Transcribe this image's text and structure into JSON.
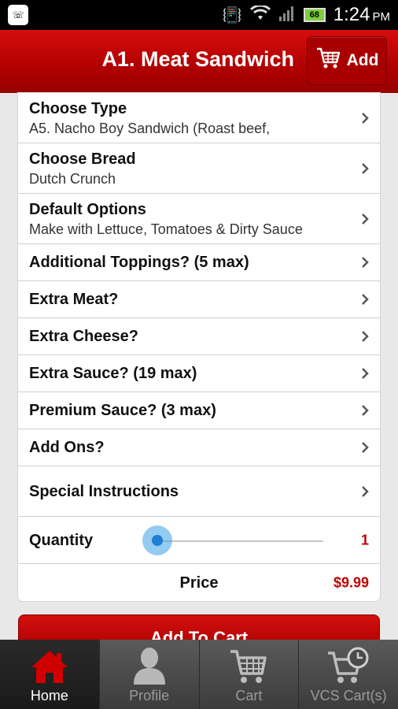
{
  "status_bar": {
    "time": "1:24",
    "ampm": "PM",
    "battery": "68",
    "left_icon": "phone-notification-icon"
  },
  "header": {
    "title": "A1. Meat Sandwich",
    "add_label": "Add",
    "add_icon": "cart-icon",
    "brand_color": "#c00000"
  },
  "options": [
    {
      "title": "Choose Type",
      "subtitle": "A5. Nacho Boy Sandwich (Roast beef,"
    },
    {
      "title": "Choose Bread",
      "subtitle": "Dutch Crunch"
    },
    {
      "title": "Default Options",
      "subtitle": "Make with Lettuce, Tomatoes & Dirty Sauce"
    },
    {
      "title": "Additional Toppings? (5 max)"
    },
    {
      "title": "Extra Meat?"
    },
    {
      "title": "Extra Cheese?"
    },
    {
      "title": "Extra Sauce? (19 max)"
    },
    {
      "title": "Premium Sauce? (3 max)"
    },
    {
      "title": "Add Ons?"
    },
    {
      "title": "Special Instructions"
    }
  ],
  "quantity": {
    "label": "Quantity",
    "value": "1",
    "slider_fraction": 0.0
  },
  "price": {
    "label": "Price",
    "value": "$9.99"
  },
  "add_to_cart_label": "Add To Cart",
  "tabs": [
    {
      "label": "Home",
      "icon": "home-icon",
      "active": true
    },
    {
      "label": "Profile",
      "icon": "profile-icon",
      "active": false
    },
    {
      "label": "Cart",
      "icon": "cart-icon",
      "active": false
    },
    {
      "label": "VCS Cart(s)",
      "icon": "scheduled-cart-icon",
      "active": false
    }
  ]
}
